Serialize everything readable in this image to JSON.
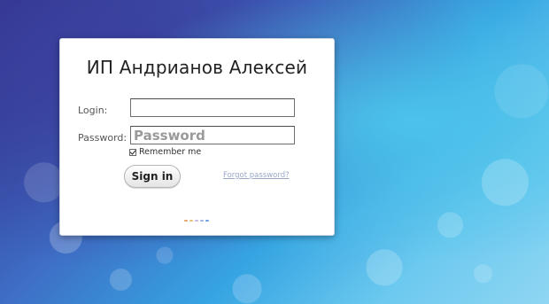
{
  "title": "ИП Андрианов Алексей",
  "form": {
    "login_label": "Login:",
    "login_value": "",
    "password_label": "Password:",
    "password_placeholder": "Password",
    "remember_label": "Remember me",
    "remember_checked": true,
    "signin_label": "Sign in",
    "forgot_label": "Forgot password?"
  },
  "loading_dots": [
    "#e8a26a",
    "#e7c27a",
    "#c9b8e0",
    "#9fb8e6",
    "#6fa0e0"
  ]
}
